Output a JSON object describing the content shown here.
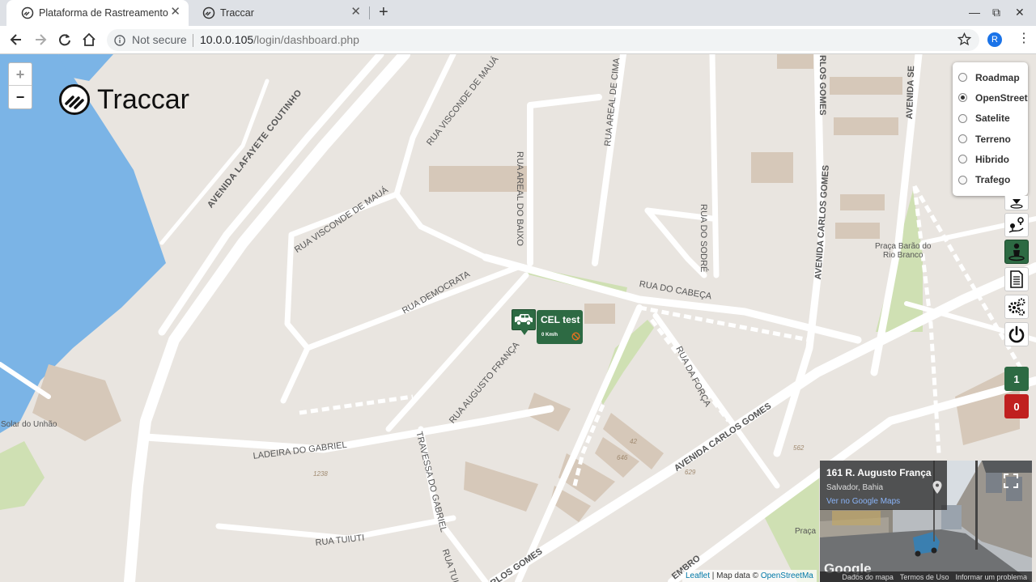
{
  "browser": {
    "tabs": [
      {
        "title": "Plataforma de Rastreamento",
        "active": true
      },
      {
        "title": "Traccar",
        "active": false
      }
    ],
    "security_label": "Not secure",
    "url_host": "10.0.0.105",
    "url_path": "/login/dashboard.php",
    "profile_initial": "R"
  },
  "app": {
    "logo_text": "Traccar"
  },
  "map": {
    "zoom_in": "+",
    "zoom_out": "−",
    "layers": [
      {
        "label": "Roadmap",
        "selected": false
      },
      {
        "label": "OpenStreet",
        "selected": true
      },
      {
        "label": "Satelite",
        "selected": false
      },
      {
        "label": "Terreno",
        "selected": false
      },
      {
        "label": "Hibrido",
        "selected": false
      },
      {
        "label": "Trafego",
        "selected": false
      }
    ],
    "counters": {
      "online": "1",
      "offline": "0",
      "online_color": "#2d6a43",
      "offline_color": "#c0201f"
    },
    "vehicle": {
      "name": "CEL test",
      "speed": "0 Km/h"
    },
    "street_labels": {
      "av_lafayete": "AVENIDA LAFAYETE COUTINHO",
      "visconde_maua_1": "RUA VISCONDE DE MAUÁ",
      "visconde_maua_2": "RUA VISCONDE DE MAUÁ",
      "areal_baixo": "RUA AREAL DO BAIXO",
      "areal_cima": "RUA AREAL DE CIMA",
      "sodre": "RUA DO SODRÉ",
      "carlos_gomes_1": "AVENIDA CARLOS GOMES",
      "carlos_gomes_2": "RLOS GOMES",
      "carlos_gomes_3": "AVENIDA CARLOS GOMES",
      "carlos_gomes_4": "RLOS GOMES",
      "av_sete": "AVENIDA SE",
      "democrata": "RUA DEMOCRATA",
      "cabeca": "RUA DO CABEÇA",
      "forca": "RUA DA FORÇA",
      "augusto_franca": "RUA AUGUSTO FRANÇA",
      "ladeira_gabriel": "LADEIRA DO GABRIEL",
      "travessa_gabriel": "TRAVESSA DO GABRIEL",
      "tuiuti_1": "RUA TUIUTI",
      "tuiuti_2": "RUA TUIUTI",
      "setembro": "EMBRO",
      "praca_barao": "Praça Barão do",
      "praca_barao_2": "Rio Branco",
      "solar_unhao": "Solar do Unhão",
      "praca_partial": "Praça",
      "num_1238": "1238",
      "num_646": "646",
      "num_42": "42",
      "num_629": "629",
      "num_562": "562"
    },
    "attribution": {
      "leaflet": "Leaflet",
      "text": " | Map data © ",
      "osm": "OpenStreetMa"
    }
  },
  "streetview": {
    "address": "161 R. Augusto França",
    "city": "Salvador, Bahia",
    "link": "Ver no Google Maps",
    "watermark": "Google",
    "footer": [
      "Dados do mapa",
      "Termos de Uso",
      "Informar um problema"
    ]
  }
}
